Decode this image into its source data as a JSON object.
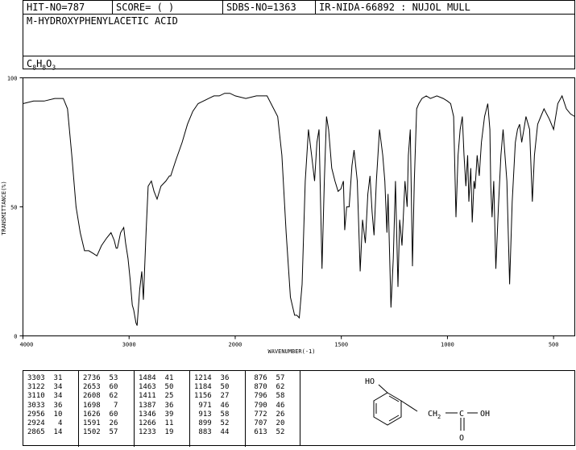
{
  "header": {
    "hit_no": "HIT-NO=787",
    "score": "SCORE=  (  )",
    "sdbs_no": "SDBS-NO=1363",
    "ir_nida": "IR-NIDA-66892 : NUJOL MULL"
  },
  "compound": {
    "name": "M-HYDROXYPHENYLACETIC ACID",
    "formula_parts": [
      "C",
      "8",
      "H",
      "8",
      "O",
      "3"
    ]
  },
  "chart_data": {
    "type": "line",
    "xlabel": "WAVENUMBER(-1)",
    "ylabel": "TRANSMITTANCE(%)",
    "xlim": [
      4000,
      400
    ],
    "ylim": [
      0,
      100
    ],
    "x_ticks": [
      4000,
      3000,
      2000,
      1500,
      1000,
      500
    ],
    "y_ticks": [
      0,
      50,
      100
    ],
    "x_tick_labels": [
      "4000",
      "3000",
      "2000",
      "1500",
      "1000",
      "500"
    ],
    "y_tick_labels": [
      "0",
      "50",
      "100"
    ],
    "series": [
      {
        "x": [
          4000,
          3900,
          3800,
          3700,
          3620,
          3580,
          3540,
          3500,
          3460,
          3420,
          3380,
          3340,
          3303,
          3260,
          3210,
          3170,
          3140,
          3122,
          3110,
          3080,
          3050,
          3033,
          3010,
          2990,
          2970,
          2956,
          2935,
          2924,
          2900,
          2880,
          2865,
          2840,
          2820,
          2790,
          2765,
          2736,
          2700,
          2653,
          2620,
          2608,
          2560,
          2500,
          2450,
          2400,
          2350,
          2300,
          2250,
          2200,
          2150,
          2100,
          2050,
          2000,
          1950,
          1900,
          1850,
          1800,
          1780,
          1760,
          1740,
          1720,
          1710,
          1698,
          1685,
          1670,
          1655,
          1640,
          1626,
          1615,
          1605,
          1591,
          1580,
          1570,
          1560,
          1545,
          1530,
          1515,
          1502,
          1490,
          1484,
          1475,
          1463,
          1450,
          1440,
          1425,
          1411,
          1400,
          1387,
          1375,
          1365,
          1355,
          1346,
          1335,
          1320,
          1305,
          1295,
          1285,
          1280,
          1266,
          1255,
          1245,
          1233,
          1225,
          1214,
          1200,
          1190,
          1184,
          1175,
          1165,
          1156,
          1145,
          1135,
          1120,
          1100,
          1080,
          1050,
          1020,
          1000,
          985,
          971,
          960,
          950,
          940,
          930,
          922,
          913,
          905,
          899,
          890,
          883,
          875,
          870,
          860,
          850,
          840,
          825,
          810,
          800,
          796,
          790,
          782,
          772,
          760,
          748,
          738,
          720,
          707,
          695,
          680,
          670,
          660,
          650,
          640,
          630,
          613,
          600,
          590,
          575,
          560,
          545,
          520,
          500,
          480,
          460,
          440,
          420,
          400
        ],
        "y": [
          90,
          91,
          91,
          92,
          92,
          88,
          70,
          50,
          40,
          33,
          33,
          32,
          31,
          35,
          38,
          40,
          37,
          34,
          34,
          40,
          42,
          36,
          30,
          22,
          12,
          10,
          5,
          4,
          18,
          25,
          14,
          40,
          58,
          60,
          56,
          53,
          58,
          60,
          62,
          62,
          68,
          75,
          82,
          87,
          90,
          91,
          92,
          93,
          93,
          94,
          94,
          93,
          92,
          93,
          93,
          85,
          70,
          40,
          15,
          8,
          8,
          7,
          20,
          60,
          80,
          70,
          60,
          75,
          80,
          26,
          60,
          85,
          80,
          65,
          60,
          56,
          57,
          60,
          41,
          50,
          50,
          66,
          72,
          60,
          25,
          45,
          36,
          55,
          62,
          48,
          39,
          60,
          80,
          70,
          60,
          40,
          55,
          11,
          30,
          60,
          19,
          45,
          35,
          60,
          50,
          70,
          80,
          27,
          60,
          88,
          90,
          92,
          93,
          92,
          93,
          92,
          91,
          90,
          85,
          46,
          70,
          80,
          85,
          70,
          58,
          70,
          52,
          65,
          44,
          60,
          57,
          70,
          62,
          75,
          85,
          90,
          80,
          58,
          46,
          60,
          26,
          50,
          70,
          80,
          60,
          20,
          52,
          75,
          80,
          82,
          75,
          80,
          85,
          80,
          52,
          70,
          82,
          85,
          88,
          84,
          80,
          90,
          93,
          88,
          86,
          85
        ]
      }
    ],
    "grid": false,
    "legend": "none"
  },
  "peaks": [
    [
      [
        "3303",
        "31"
      ],
      [
        "3122",
        "34"
      ],
      [
        "3110",
        "34"
      ],
      [
        "3033",
        "36"
      ],
      [
        "2956",
        "10"
      ],
      [
        "2924",
        "4"
      ],
      [
        "2865",
        "14"
      ]
    ],
    [
      [
        "2736",
        "53"
      ],
      [
        "2653",
        "60"
      ],
      [
        "2608",
        "62"
      ],
      [
        "1698",
        "7"
      ],
      [
        "1626",
        "60"
      ],
      [
        "1591",
        "26"
      ],
      [
        "1502",
        "57"
      ]
    ],
    [
      [
        "1484",
        "41"
      ],
      [
        "1463",
        "50"
      ],
      [
        "1411",
        "25"
      ],
      [
        "1387",
        "36"
      ],
      [
        "1346",
        "39"
      ],
      [
        "1266",
        "11"
      ],
      [
        "1233",
        "19"
      ]
    ],
    [
      [
        "1214",
        "36"
      ],
      [
        "1184",
        "50"
      ],
      [
        "1156",
        "27"
      ],
      [
        "971",
        "46"
      ],
      [
        "913",
        "58"
      ],
      [
        "899",
        "52"
      ],
      [
        "883",
        "44"
      ]
    ],
    [
      [
        "876",
        "57"
      ],
      [
        "870",
        "62"
      ],
      [
        "796",
        "58"
      ],
      [
        "790",
        "46"
      ],
      [
        "772",
        "26"
      ],
      [
        "707",
        "20"
      ],
      [
        "613",
        "52"
      ]
    ]
  ],
  "structure": {
    "oh_label": "HO",
    "ch2_label": "CH",
    "ch2_sub": "2",
    "c_label": "C",
    "oh2_label": "OH",
    "o_label": "O"
  },
  "colors": {
    "line": "#000000",
    "background": "#ffffff"
  }
}
